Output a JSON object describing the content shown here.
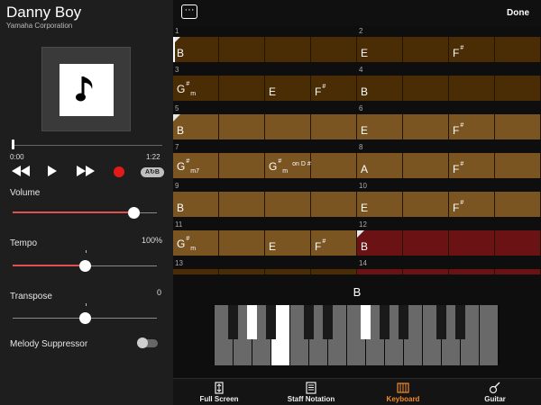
{
  "song": {
    "title": "Danny Boy",
    "artist": "Yamaha Corporation",
    "art_icon": "music-note-icon"
  },
  "playback": {
    "time_current": "0:00",
    "time_total": "1:22",
    "position": 0.0,
    "ab_label": "A↻B"
  },
  "controls": {
    "volume_label": "Volume",
    "volume_level": 0.84,
    "tempo_label": "Tempo",
    "tempo_value": "100%",
    "tempo_level": 0.5,
    "transpose_label": "Transpose",
    "transpose_value": "0",
    "transpose_level": 0.5,
    "melody_suppressor_label": "Melody Suppressor",
    "melody_suppressor_on": false
  },
  "topbar": {
    "menu_label": "···",
    "done_label": "Done"
  },
  "chord_grid": [
    {
      "num_a": "1",
      "num_b": "2",
      "shade": "dark",
      "cells": [
        {
          "r": "B",
          "start": true,
          "cursor": true
        },
        {
          "r": ""
        },
        {
          "r": ""
        },
        {
          "r": ""
        },
        {
          "r": "E"
        },
        {
          "r": ""
        },
        {
          "r": "F",
          "sup": "#"
        },
        {
          "r": ""
        }
      ]
    },
    {
      "num_a": "3",
      "num_b": "4",
      "shade": "dark",
      "cells": [
        {
          "r": "G",
          "sup": "#",
          "sub": "m"
        },
        {
          "r": ""
        },
        {
          "r": "E"
        },
        {
          "r": "F",
          "sup": "#"
        },
        {
          "r": "B"
        },
        {
          "r": ""
        },
        {
          "r": ""
        },
        {
          "r": ""
        }
      ]
    },
    {
      "num_a": "5",
      "num_b": "6",
      "shade": "light",
      "cells": [
        {
          "r": "B",
          "start": true
        },
        {
          "r": ""
        },
        {
          "r": ""
        },
        {
          "r": ""
        },
        {
          "r": "E"
        },
        {
          "r": ""
        },
        {
          "r": "F",
          "sup": "#"
        },
        {
          "r": ""
        }
      ]
    },
    {
      "num_a": "7",
      "num_b": "8",
      "shade": "light",
      "cells": [
        {
          "r": "G",
          "sup": "#",
          "sub": "m7"
        },
        {
          "r": ""
        },
        {
          "r": "G",
          "sup": "#",
          "sub": "m",
          "bass": "on D #"
        },
        {
          "r": ""
        },
        {
          "r": "A"
        },
        {
          "r": ""
        },
        {
          "r": "F",
          "sup": "#"
        },
        {
          "r": ""
        }
      ]
    },
    {
      "num_a": "9",
      "num_b": "10",
      "shade": "light",
      "cells": [
        {
          "r": "B"
        },
        {
          "r": ""
        },
        {
          "r": ""
        },
        {
          "r": ""
        },
        {
          "r": "E"
        },
        {
          "r": ""
        },
        {
          "r": "F",
          "sup": "#"
        },
        {
          "r": ""
        }
      ]
    },
    {
      "num_a": "11",
      "num_b": "12",
      "shade": "light",
      "cells": [
        {
          "r": "G",
          "sup": "#",
          "sub": "m"
        },
        {
          "r": ""
        },
        {
          "r": "E"
        },
        {
          "r": "F",
          "sup": "#"
        },
        {
          "r": "B",
          "start": true,
          "hl": true
        },
        {
          "r": "",
          "hl": true
        },
        {
          "r": "",
          "hl": true
        },
        {
          "r": "",
          "hl": true
        }
      ]
    },
    {
      "num_a": "13",
      "num_b": "14",
      "shade": "dark",
      "cells": [
        {
          "r": ""
        },
        {
          "r": ""
        },
        {
          "r": ""
        },
        {
          "r": ""
        },
        {
          "r": "",
          "hl": true
        },
        {
          "r": "",
          "hl": true
        },
        {
          "r": "",
          "hl": true
        },
        {
          "r": "",
          "hl": true
        }
      ]
    }
  ],
  "keyboard": {
    "chord_name": "B",
    "pressed_white_keys": [
      3
    ],
    "pressed_black_keys": [
      1,
      5
    ]
  },
  "tabs": [
    {
      "label": "Full Screen",
      "icon": "fullscreen-icon",
      "active": false
    },
    {
      "label": "Staff Notation",
      "icon": "staff-notation-icon",
      "active": false
    },
    {
      "label": "Keyboard",
      "icon": "keyboard-icon",
      "active": true
    },
    {
      "label": "Guitar",
      "icon": "guitar-icon",
      "active": false
    }
  ],
  "colors": {
    "accent": "#f08a2a",
    "record": "#e41a1a",
    "highlight": "#6b1214",
    "bar_dark": "#4a2c05",
    "bar_light": "#7a5522"
  }
}
